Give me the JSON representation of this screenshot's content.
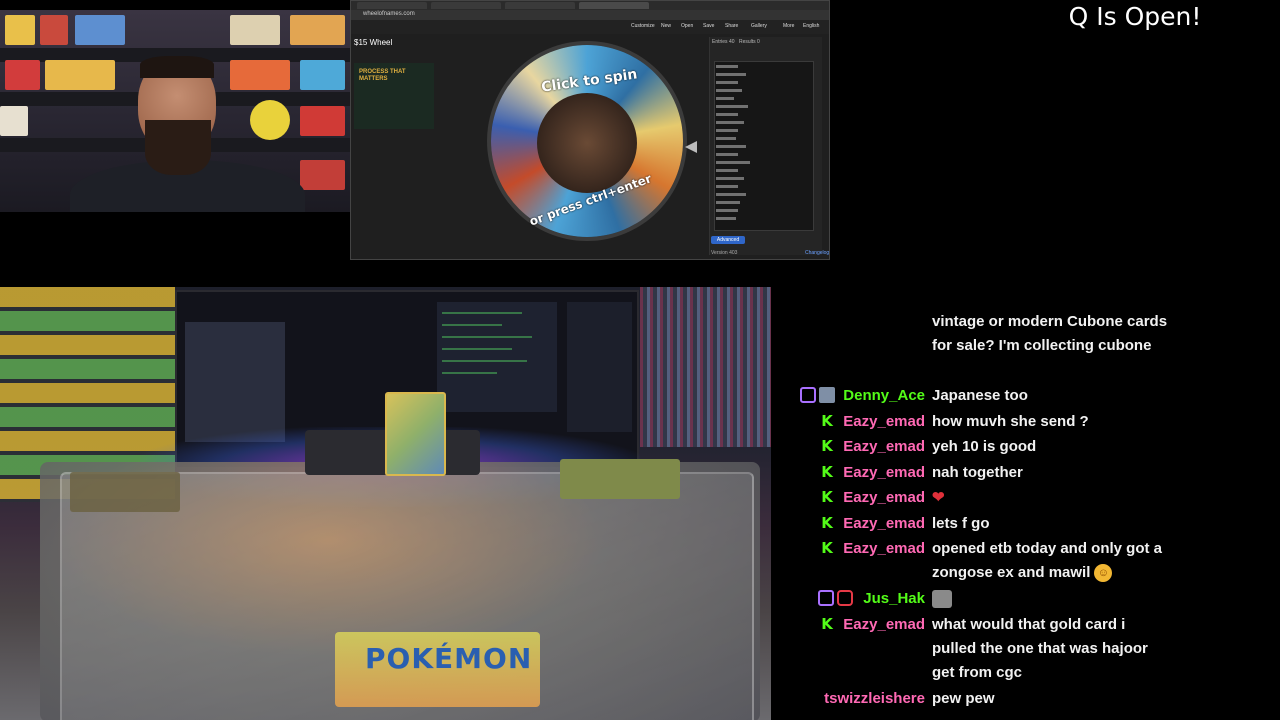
{
  "overlay": {
    "title": "Q Is Open!"
  },
  "browser": {
    "url": "wheelofnames.com",
    "menu": [
      "Customize",
      "New",
      "Open",
      "Save",
      "Share",
      "Gallery",
      "More",
      "English"
    ],
    "wheel_title": "$15 Wheel",
    "ad_headline": "PROCESS THAT MATTERS",
    "wheel_text_top": "Click to spin",
    "wheel_text_bottom": "or press ctrl+enter",
    "panel_tabs": [
      "Entries 40",
      "Results 0"
    ],
    "panel_button": "Advanced",
    "panel_footer_left": "Version 403",
    "panel_footer_right": "Changelog"
  },
  "table_cam": {
    "pack_logo": "POKÉMON"
  },
  "chat": {
    "messages": [
      {
        "user": "",
        "color": "#ffffff",
        "badges": [],
        "text": "vintage or modern Cubone cards for sale? I'm collecting cubone"
      },
      {
        "user": "Denny_Ace",
        "color": "#53fc18",
        "badges": [
          "twitch",
          "sub"
        ],
        "text": "Japanese too"
      },
      {
        "user": "Eazy_emad",
        "color": "#ff69b4",
        "badges": [
          "kick"
        ],
        "text": "how muvh she send ?"
      },
      {
        "user": "Eazy_emad",
        "color": "#ff69b4",
        "badges": [
          "kick"
        ],
        "text": "yeh 10 is good"
      },
      {
        "user": "Eazy_emad",
        "color": "#ff69b4",
        "badges": [
          "kick"
        ],
        "text": "nah together"
      },
      {
        "user": "Eazy_emad",
        "color": "#ff69b4",
        "badges": [
          "kick"
        ],
        "text": "",
        "emote": "heart"
      },
      {
        "user": "Eazy_emad",
        "color": "#ff69b4",
        "badges": [
          "kick"
        ],
        "text": "lets f go"
      },
      {
        "user": "Eazy_emad",
        "color": "#ff69b4",
        "badges": [
          "kick"
        ],
        "text": "opened etb today and only got a zongose ex and mawil",
        "emote": "laugh"
      },
      {
        "user": "Jus_Hak",
        "color": "#53fc18",
        "badges": [
          "twitch",
          "red"
        ],
        "text": "",
        "emote": "image"
      },
      {
        "user": "Eazy_emad",
        "color": "#ff69b4",
        "badges": [
          "kick"
        ],
        "text": "what would that gold card i pulled the one that was hajoor get from cgc"
      },
      {
        "user": "tswizzleishere",
        "color": "#ff69b4",
        "badges": [
          "twitch"
        ],
        "text": "pew pew"
      }
    ]
  },
  "colors": {
    "kick_green": "#53fc18",
    "twitch_purple": "#a970ff",
    "chat_text": "#f2f2f2"
  }
}
